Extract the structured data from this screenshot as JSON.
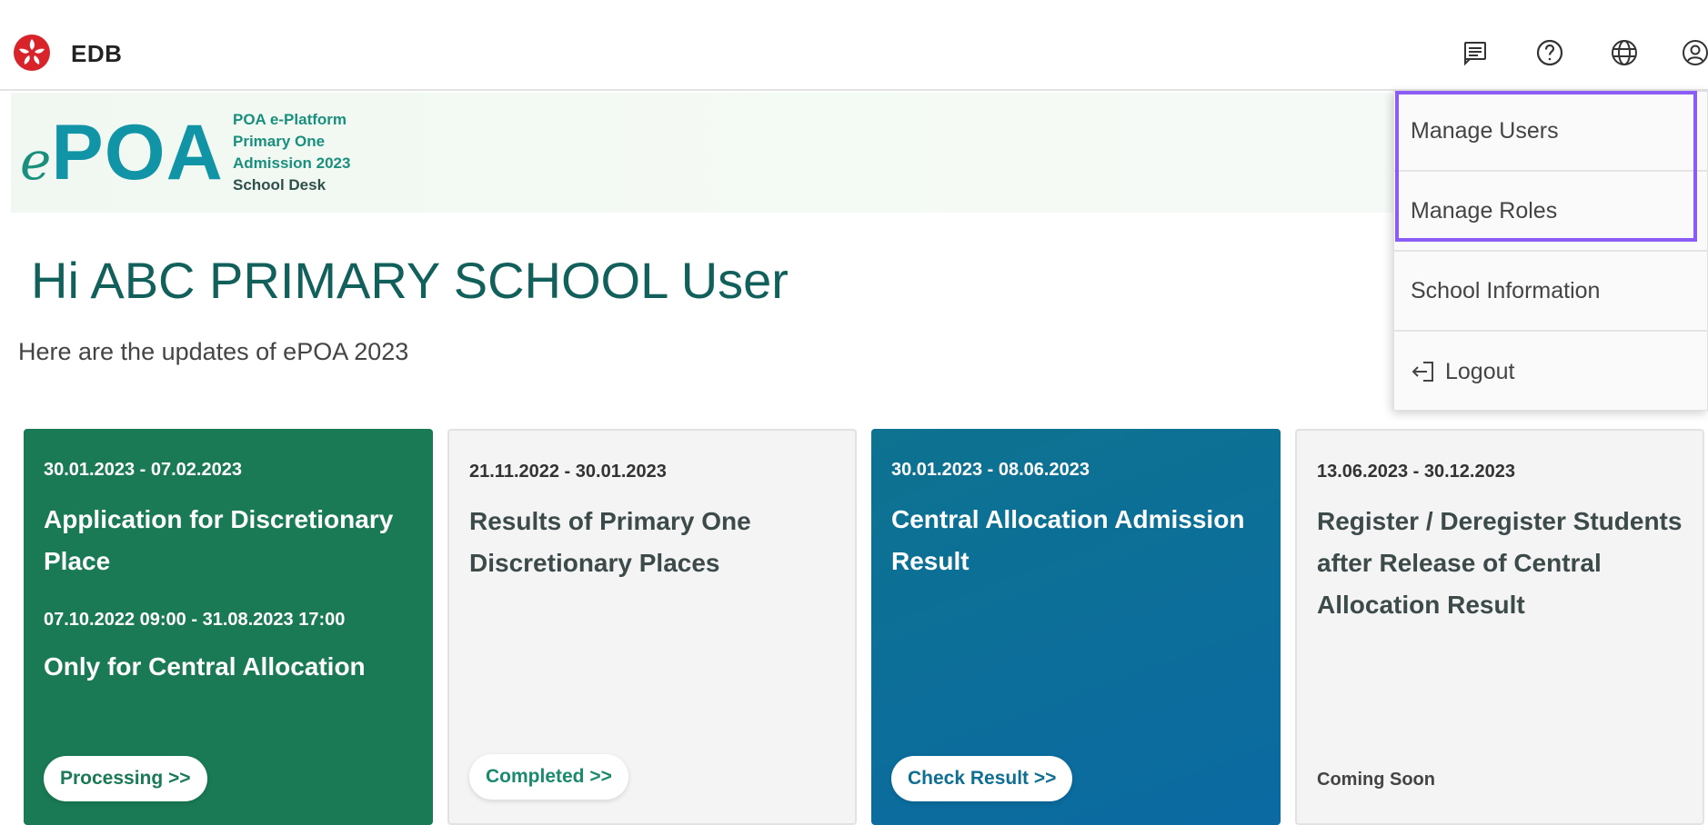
{
  "header": {
    "brand": "EDB",
    "icons": [
      "message-icon",
      "help-icon",
      "globe-icon",
      "user-icon"
    ]
  },
  "banner": {
    "logo_e": "e",
    "logo_poa": "POA",
    "line1": "POA e-Platform",
    "line2": "Primary One",
    "line3": "Admission 2023",
    "line4": "School Desk"
  },
  "greeting": "Hi ABC PRIMARY SCHOOL User",
  "subtitle": "Here are the updates of ePOA 2023",
  "cards": [
    {
      "date": "30.01.2023 - 07.02.2023",
      "title": "Application for Discretionary Place",
      "date2": "07.10.2022 09:00 - 31.08.2023 17:00",
      "title2": "Only for Central Allocation",
      "action": "Processing >>"
    },
    {
      "date": "21.11.2022 - 30.01.2023",
      "title": "Results of Primary One Discretionary Places",
      "action": "Completed >>"
    },
    {
      "date": "30.01.2023 - 08.06.2023",
      "title": "Central Allocation Admission Result",
      "action": "Check Result >>"
    },
    {
      "date": "13.06.2023 - 30.12.2023",
      "title": "Register / Deregister Students after Release of Central Allocation Result",
      "status": "Coming Soon"
    }
  ],
  "menu": {
    "items": [
      "Manage Users",
      "Manage Roles",
      "School Information",
      "Logout"
    ]
  },
  "colors": {
    "green_card": "#1a7a55",
    "blue_card": "#0b6aa2",
    "greeting": "#11605c",
    "highlight": "#8b5cf6"
  }
}
